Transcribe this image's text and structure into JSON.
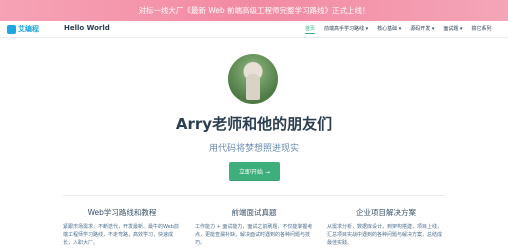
{
  "banner": {
    "text": "对标一线大厂《最新 Web 前端高级工程师完整学习路线》正式上线！"
  },
  "nav": {
    "logo_text": "艾编程",
    "site_name": "Hello World",
    "items": [
      {
        "label": "首页",
        "active": true
      },
      {
        "label": "前端高手学习路线 ▾"
      },
      {
        "label": "核心基础 ▾"
      },
      {
        "label": "源码开发 ▾"
      },
      {
        "label": "面试题 ▾"
      },
      {
        "label": "搞它系列"
      }
    ]
  },
  "hero": {
    "title": "Arry老师和他的朋友们",
    "subtitle": "用代码将梦想照进现实",
    "cta_label": "立即开始 →"
  },
  "features": [
    {
      "title": "Web学习路线和教程",
      "text": "紧跟市场需求，不断迭代，开发最新、最牛的Web前端工程师学习路线，不走弯路，高效学习，快速成长，入职大厂。"
    },
    {
      "title": "前端面试真题",
      "text": "工作能力 + 面试能力，面试之前刷题，不仅能掌握考点，更能查漏补缺，解决面试时遇到的各种问题与技巧。"
    },
    {
      "title": "企业项目解决方案",
      "text": "从需求分析，数据库设计，到架构搭建，项目上线，汇总项目实战中遇到的各种问题与解决方案，总结成最佳实践。"
    }
  ],
  "colors": {
    "accent": "#3eaf7c",
    "banner": "#f28aa3",
    "logo": "#1ea7e1"
  }
}
